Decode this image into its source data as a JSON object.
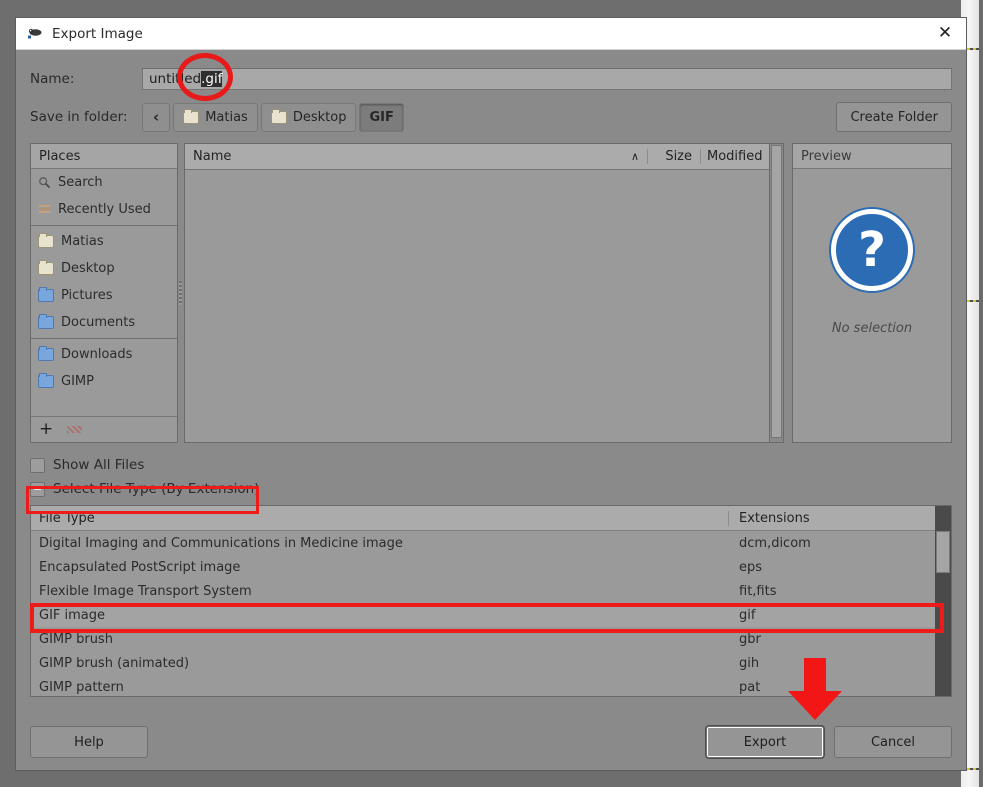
{
  "window": {
    "title": "Export Image",
    "title_icon": "gimp-wilber-icon",
    "close_label": "✕"
  },
  "name_row": {
    "label": "Name:",
    "value_prefix": "untitled",
    "value_selected": ".gif",
    "full_value": "untitled.gif"
  },
  "folder_row": {
    "label": "Save in folder:",
    "back_glyph": "‹",
    "crumbs": [
      {
        "label": "Matias",
        "icon": "folder-icon",
        "icon_color": "cream",
        "active": false
      },
      {
        "label": "Desktop",
        "icon": "folder-icon",
        "icon_color": "cream",
        "active": false
      },
      {
        "label": "GIF",
        "icon": "none",
        "icon_color": "none",
        "active": true
      }
    ],
    "create_folder_label": "Create Folder"
  },
  "places": {
    "header": "Places",
    "items": [
      {
        "label": "Search",
        "icon": "search-icon"
      },
      {
        "label": "Recently Used",
        "icon": "recent-icon"
      },
      {
        "label": "Matias",
        "icon": "folder-icon-cream"
      },
      {
        "label": "Desktop",
        "icon": "folder-icon-cream"
      },
      {
        "label": "Pictures",
        "icon": "folder-icon-blue"
      },
      {
        "label": "Documents",
        "icon": "folder-icon-blue"
      },
      {
        "label": "Downloads",
        "icon": "folder-icon-blue"
      },
      {
        "label": "GIMP",
        "icon": "folder-icon-blue"
      }
    ],
    "add_label": "+",
    "remove_label": ""
  },
  "file_list": {
    "columns": {
      "name": "Name",
      "size": "Size",
      "modified": "Modified"
    },
    "sort_arrow": "∧",
    "rows": []
  },
  "preview": {
    "header": "Preview",
    "icon": "question-mark-icon",
    "icon_glyph": "?",
    "caption": "No selection"
  },
  "options": {
    "show_all_files": {
      "label": "Show All Files",
      "checked": false
    },
    "select_file_type": {
      "label": "Select File Type (By Extension)",
      "expanded": true
    }
  },
  "file_types": {
    "columns": {
      "type": "File Type",
      "extensions": "Extensions"
    },
    "rows": [
      {
        "type": "Digital Imaging and Communications in Medicine image",
        "extensions": "dcm,dicom",
        "selected": false
      },
      {
        "type": "Encapsulated PostScript image",
        "extensions": "eps",
        "selected": false
      },
      {
        "type": "Flexible Image Transport System",
        "extensions": "fit,fits",
        "selected": false
      },
      {
        "type": "GIF image",
        "extensions": "gif",
        "selected": true
      },
      {
        "type": "GIMP brush",
        "extensions": "gbr",
        "selected": false
      },
      {
        "type": "GIMP brush (animated)",
        "extensions": "gih",
        "selected": false
      },
      {
        "type": "GIMP pattern",
        "extensions": "pat",
        "selected": false
      }
    ]
  },
  "actions": {
    "help_label": "Help",
    "export_label": "Export",
    "cancel_label": "Cancel"
  },
  "annotations": {
    "color": "#ee1b1b",
    "circle_target": "gif-extension-in-name-field",
    "box_expander_target": "select-file-type-expander",
    "box_row_target": "gif-image-file-type-row",
    "arrow_target": "export-button"
  }
}
